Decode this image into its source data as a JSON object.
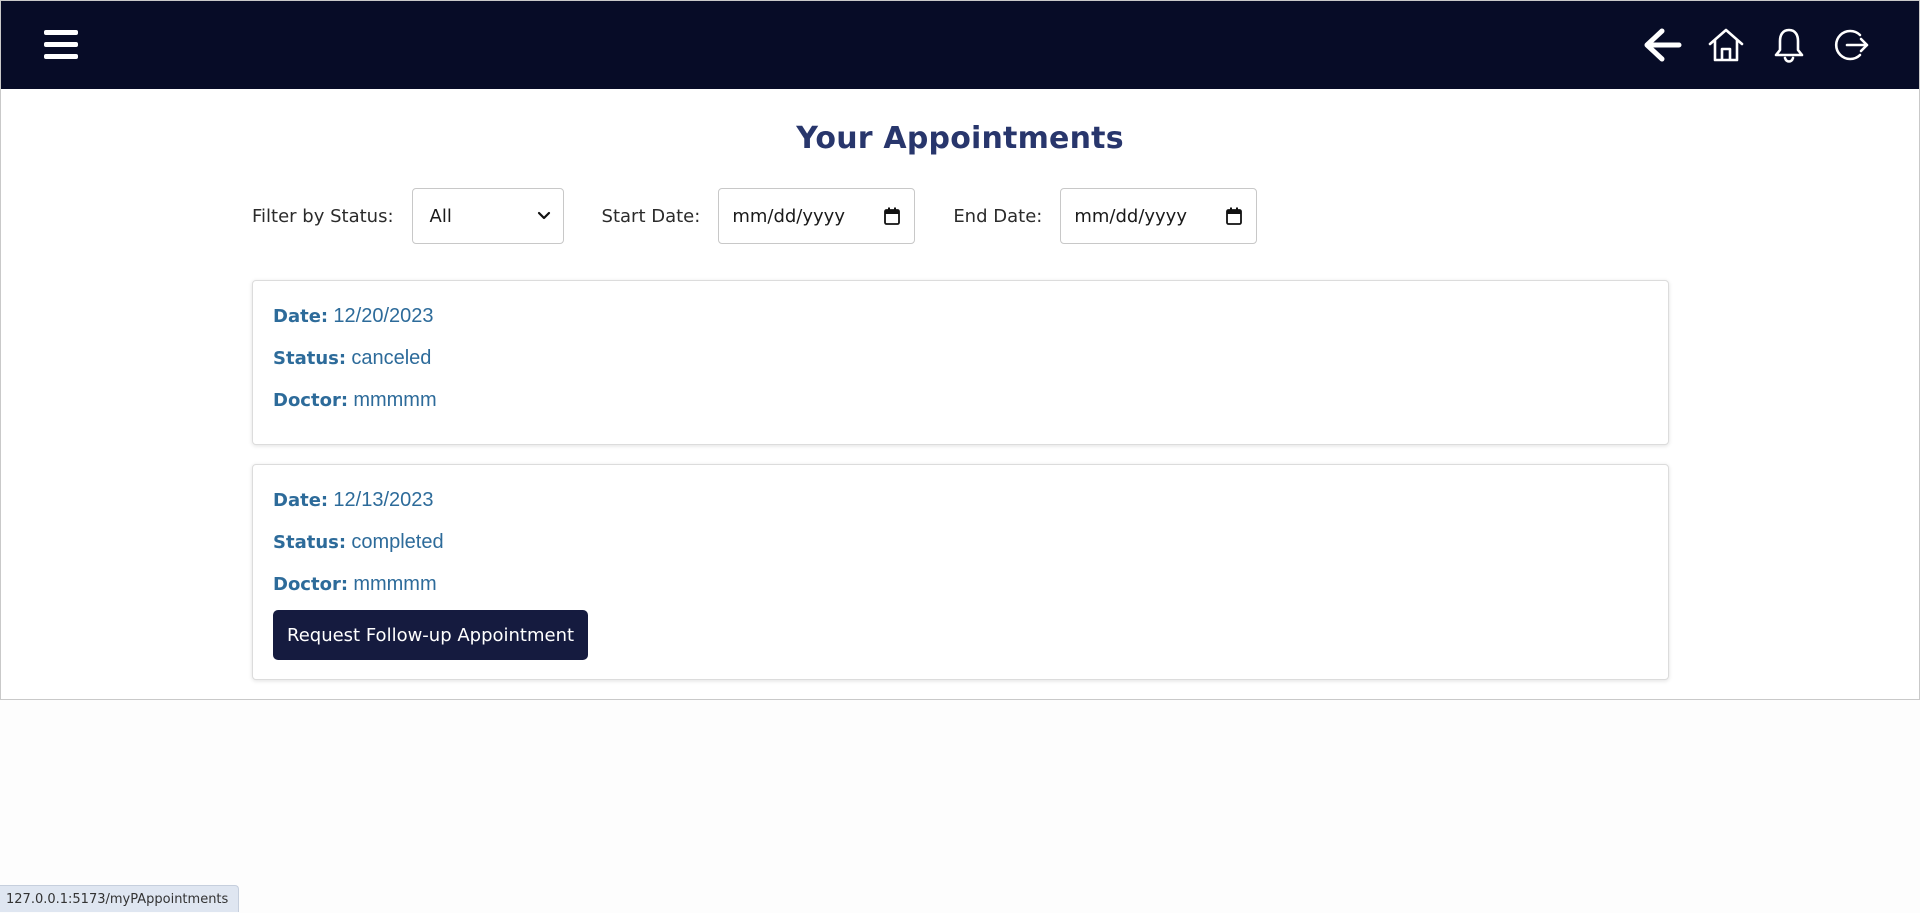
{
  "header": {
    "menu_icon": "hamburger-menu-icon",
    "icons": [
      "arrow-left-icon",
      "home-icon",
      "bell-icon",
      "logout-icon"
    ]
  },
  "page": {
    "title": "Your Appointments"
  },
  "filters": {
    "status_label": "Filter by Status:",
    "status_value": "All",
    "start_label": "Start Date:",
    "start_placeholder": "mm/dd/yyyy",
    "end_label": "End Date:",
    "end_placeholder": "mm/dd/yyyy"
  },
  "appointments": [
    {
      "date_label": "Date:",
      "date": "12/20/2023",
      "status_label": "Status:",
      "status": "canceled",
      "doctor_label": "Doctor:",
      "doctor": "mmmmm"
    },
    {
      "date_label": "Date:",
      "date": "12/13/2023",
      "status_label": "Status:",
      "status": "completed",
      "doctor_label": "Doctor:",
      "doctor": "mmmmm",
      "action_label": "Request Follow-up Appointment"
    }
  ],
  "statusbar": {
    "url": "127.0.0.1:5173/myPAppointments"
  },
  "colors": {
    "navbar": "#070c27",
    "title": "#28366c",
    "card_text": "#2d6b9a",
    "button": "#151b3f"
  }
}
